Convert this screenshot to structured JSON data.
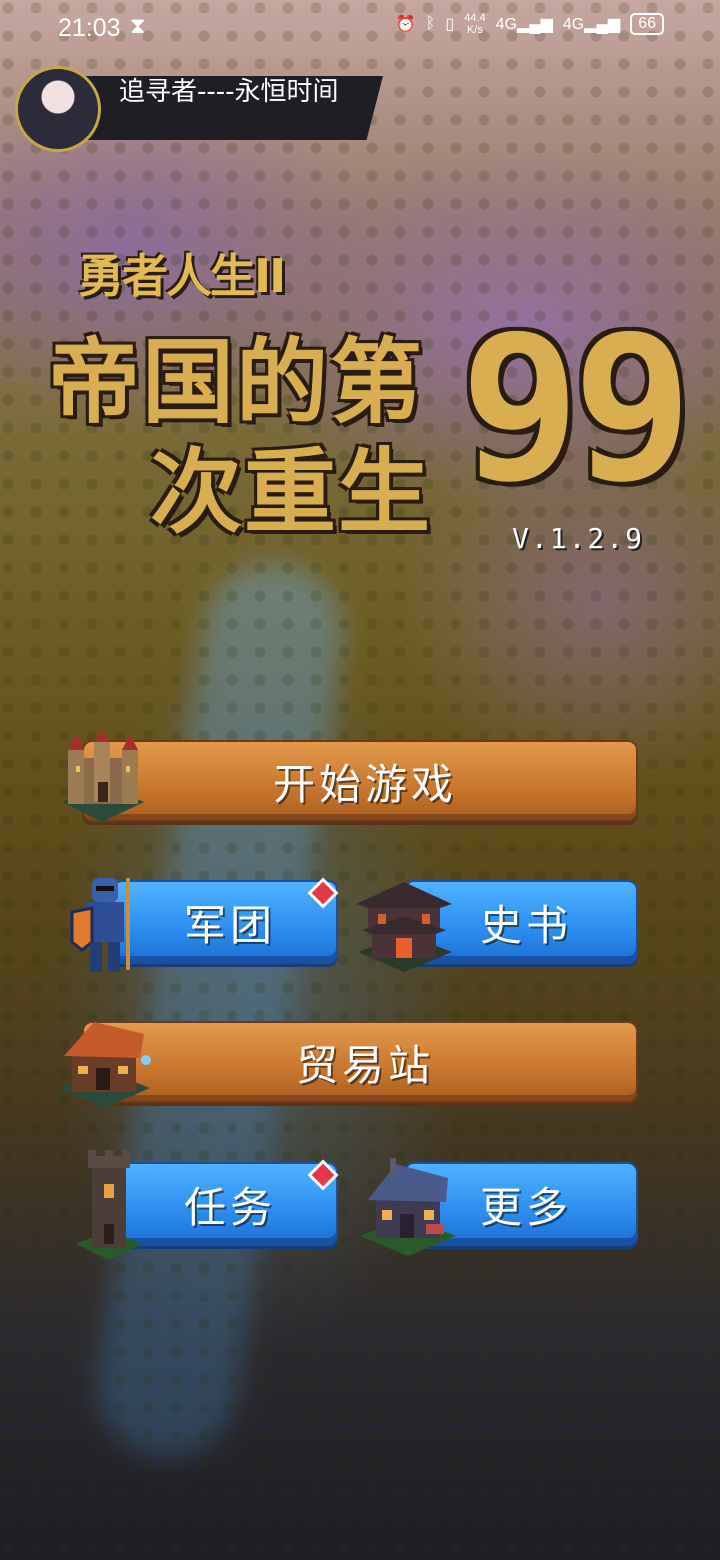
{
  "status_bar": {
    "time": "21:03",
    "net_speed_value": "44.4",
    "net_speed_unit": "K/s",
    "signal1": "4G",
    "signal2": "4G",
    "battery": "66"
  },
  "user": {
    "name": "追寻者----永恒时间"
  },
  "game_title": {
    "subtitle": "勇者人生II",
    "line1": "帝国的第",
    "line2": "次重生",
    "number": "99",
    "version": "V.1.2.9"
  },
  "menu": {
    "start_label": "开始游戏",
    "legion_label": "军团",
    "history_label": "史书",
    "trade_label": "贸易站",
    "quests_label": "任务",
    "more_label": "更多"
  },
  "colors": {
    "orange_button": "#c8762d",
    "blue_button": "#2c8df0",
    "title_gold": "#d8ae50",
    "badge_red": "#e3384a"
  },
  "icons": [
    "castle-icon",
    "knight-icon",
    "temple-icon",
    "shop-icon",
    "tower-icon",
    "house-icon",
    "hourglass-icon",
    "alarm-icon",
    "bluetooth-icon",
    "vibrate-icon",
    "signal-icon",
    "battery-icon"
  ]
}
